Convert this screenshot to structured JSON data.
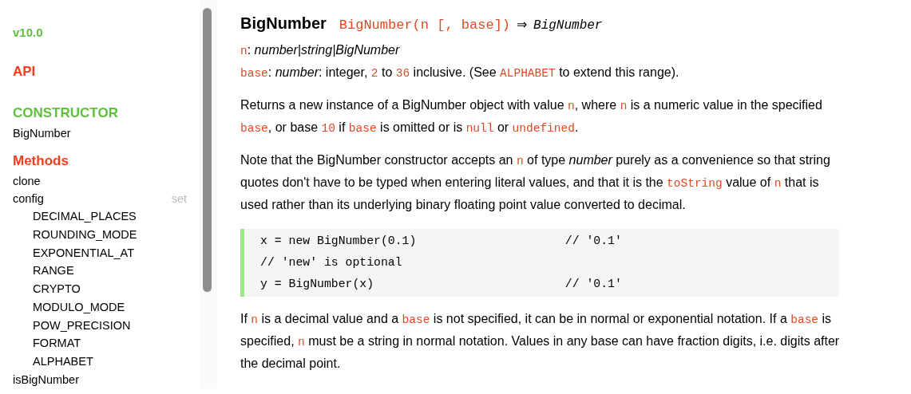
{
  "sidebar": {
    "version": "v10.0",
    "api": "API",
    "sections": [
      {
        "heading": "CONSTRUCTOR",
        "kind": "constructor",
        "items": [
          {
            "label": "BigNumber"
          }
        ]
      },
      {
        "heading": "Methods",
        "kind": "methods",
        "items": [
          {
            "label": "clone"
          },
          {
            "label": "config",
            "aside": "set",
            "children": [
              {
                "label": "DECIMAL_PLACES"
              },
              {
                "label": "ROUNDING_MODE"
              },
              {
                "label": "EXPONENTIAL_AT"
              },
              {
                "label": "RANGE"
              },
              {
                "label": "CRYPTO"
              },
              {
                "label": "MODULO_MODE"
              },
              {
                "label": "POW_PRECISION"
              },
              {
                "label": "FORMAT"
              },
              {
                "label": "ALPHABET"
              }
            ]
          },
          {
            "label": "isBigNumber"
          }
        ]
      }
    ]
  },
  "content": {
    "title": "BigNumber",
    "signature": "BigNumber(n [, base])",
    "arrow": "⇒",
    "returns": "BigNumber",
    "params": [
      [
        {
          "kind": "code",
          "text": "n"
        },
        {
          "kind": "text",
          "text": ": "
        },
        {
          "kind": "em",
          "text": "number|string|BigNumber"
        }
      ],
      [
        {
          "kind": "code",
          "text": "base"
        },
        {
          "kind": "text",
          "text": ": "
        },
        {
          "kind": "em",
          "text": "number"
        },
        {
          "kind": "text",
          "text": ": integer, "
        },
        {
          "kind": "code",
          "text": "2"
        },
        {
          "kind": "text",
          "text": " to "
        },
        {
          "kind": "code",
          "text": "36"
        },
        {
          "kind": "text",
          "text": " inclusive. (See "
        },
        {
          "kind": "code",
          "text": "ALPHABET"
        },
        {
          "kind": "text",
          "text": " to extend this range)."
        }
      ]
    ],
    "paragraphs_before": [
      [
        {
          "kind": "text",
          "text": "Returns a new instance of a BigNumber object with value "
        },
        {
          "kind": "code",
          "text": "n"
        },
        {
          "kind": "text",
          "text": ", where "
        },
        {
          "kind": "code",
          "text": "n"
        },
        {
          "kind": "text",
          "text": " is a numeric value in the specified "
        },
        {
          "kind": "code",
          "text": "base"
        },
        {
          "kind": "text",
          "text": ", or base "
        },
        {
          "kind": "code",
          "text": "10"
        },
        {
          "kind": "text",
          "text": " if "
        },
        {
          "kind": "code",
          "text": "base"
        },
        {
          "kind": "text",
          "text": " is omitted or is "
        },
        {
          "kind": "code",
          "text": "null"
        },
        {
          "kind": "text",
          "text": " or "
        },
        {
          "kind": "code",
          "text": "undefined"
        },
        {
          "kind": "text",
          "text": "."
        }
      ],
      [
        {
          "kind": "text",
          "text": "Note that the BigNumber constructor accepts an "
        },
        {
          "kind": "code",
          "text": "n"
        },
        {
          "kind": "text",
          "text": " of type "
        },
        {
          "kind": "em",
          "text": "number"
        },
        {
          "kind": "text",
          "text": " purely as a convenience so that string quotes don't have to be typed when entering literal values, and that it is the "
        },
        {
          "kind": "code",
          "text": "toString"
        },
        {
          "kind": "text",
          "text": " value of "
        },
        {
          "kind": "code",
          "text": "n"
        },
        {
          "kind": "text",
          "text": " that is used rather than its underlying binary floating point value converted to decimal."
        }
      ]
    ],
    "code_lines": [
      "x = new BigNumber(0.1)                     // '0.1'",
      "// 'new' is optional",
      "y = BigNumber(x)                           // '0.1'"
    ],
    "paragraphs_after": [
      [
        {
          "kind": "text",
          "text": "If "
        },
        {
          "kind": "code",
          "text": "n"
        },
        {
          "kind": "text",
          "text": " is a decimal value and a "
        },
        {
          "kind": "code",
          "text": "base"
        },
        {
          "kind": "text",
          "text": " is not specified, it can be in normal or exponential notation. If a "
        },
        {
          "kind": "code",
          "text": "base"
        },
        {
          "kind": "text",
          "text": " is specified, "
        },
        {
          "kind": "code",
          "text": "n"
        },
        {
          "kind": "text",
          "text": " must be a string in normal notation. Values in any base can have fraction digits, i.e. digits after the decimal point."
        }
      ]
    ]
  }
}
